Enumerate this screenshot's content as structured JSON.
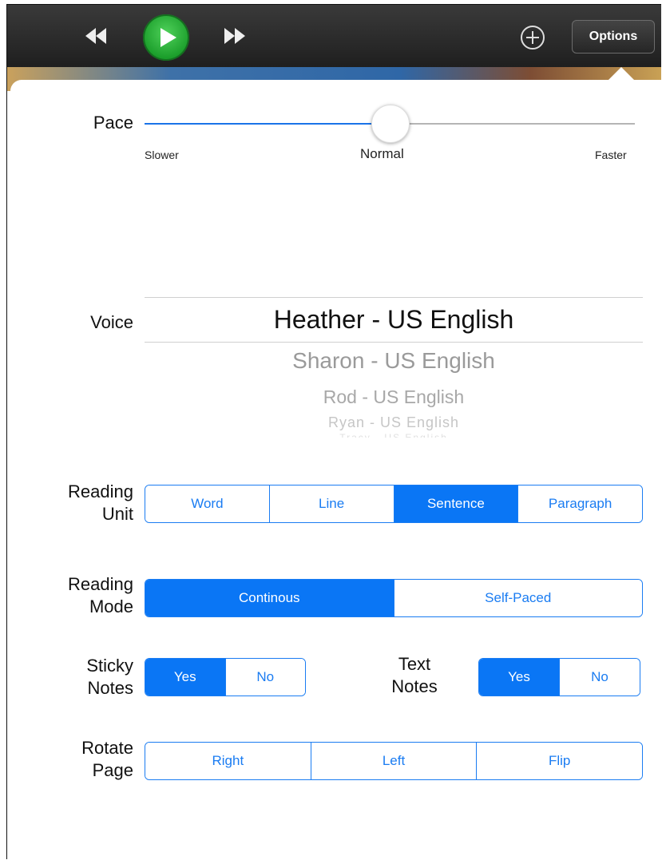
{
  "toolbar": {
    "rewind_icon": "rewind-icon",
    "play_icon": "play-icon",
    "forward_icon": "fast-forward-icon",
    "add_icon": "add-circle-icon",
    "options_label": "Options"
  },
  "pace": {
    "label": "Pace",
    "slower": "Slower",
    "normal": "Normal",
    "faster": "Faster",
    "value": 0.5
  },
  "voice": {
    "label": "Voice",
    "selected": "Heather - US English",
    "options": [
      "Sharon - US English",
      "Rod - US English",
      "Ryan - US English",
      "Tracy - US English"
    ]
  },
  "reading_unit": {
    "label_line1": "Reading",
    "label_line2": "Unit",
    "options": [
      "Word",
      "Line",
      "Sentence",
      "Paragraph"
    ],
    "selected": "Sentence"
  },
  "reading_mode": {
    "label_line1": "Reading",
    "label_line2": "Mode",
    "options": [
      "Continous",
      "Self-Paced"
    ],
    "selected": "Continous"
  },
  "sticky_notes": {
    "label_line1": "Sticky",
    "label_line2": "Notes",
    "options": [
      "Yes",
      "No"
    ],
    "selected": "Yes"
  },
  "text_notes": {
    "label_line1": "Text",
    "label_line2": "Notes",
    "options": [
      "Yes",
      "No"
    ],
    "selected": "Yes"
  },
  "rotate_page": {
    "label_line1": "Rotate",
    "label_line2": "Page",
    "options": [
      "Right",
      "Left",
      "Flip"
    ]
  },
  "colors": {
    "accent": "#0a76f5",
    "play_green": "#1a9d2a"
  }
}
